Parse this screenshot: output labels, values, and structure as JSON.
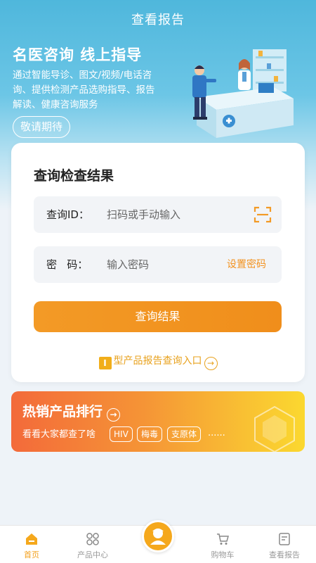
{
  "nav": {
    "title": "查看报告"
  },
  "hero": {
    "headline": "名医咨询  线上指导",
    "description": "通过智能导诊、图文/视频/电话咨询、提供检测产品选购指导、报告解读、健康咨询服务",
    "button_label": "敬请期待"
  },
  "query": {
    "title": "查询检查结果",
    "id_label": "查询ID：",
    "id_placeholder": "扫码或手动输入",
    "pw_label": "密   码：",
    "pw_placeholder": "输入密码",
    "set_password": "设置密码",
    "submit_label": "查询结果",
    "type1_badge": "I",
    "type1_link": "型产品报告查询入口"
  },
  "hot": {
    "title": "热销产品排行",
    "subtitle": "看看大家都查了啥",
    "tags": [
      "HIV",
      "梅毒",
      "支原体"
    ],
    "more": "......"
  },
  "tabbar": {
    "items": [
      {
        "label": "首页",
        "icon": "home-icon"
      },
      {
        "label": "产品中心",
        "icon": "grid-icon"
      },
      {
        "label": "",
        "icon": "doctor-icon"
      },
      {
        "label": "购物车",
        "icon": "cart-icon"
      },
      {
        "label": "查看报告",
        "icon": "report-icon"
      }
    ],
    "active_index": 0
  },
  "colors": {
    "accent": "#f39a26",
    "hero": "#4fb7dc"
  }
}
